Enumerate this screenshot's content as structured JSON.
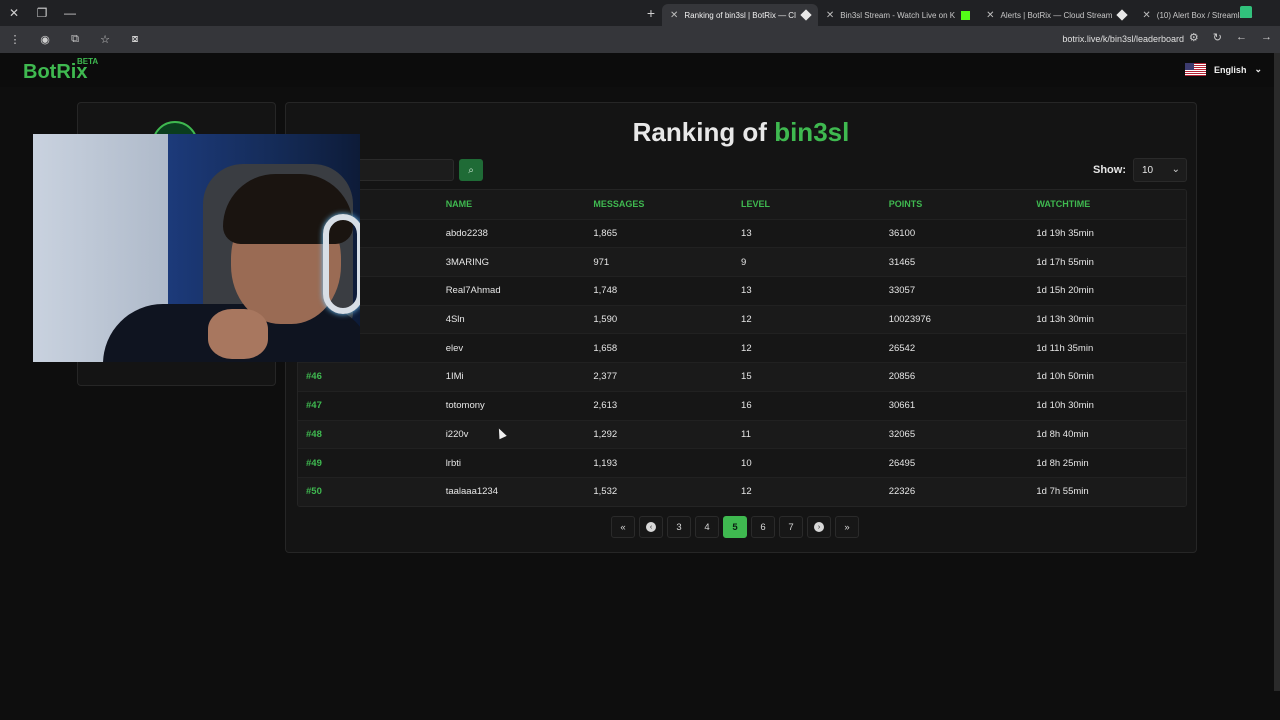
{
  "browser": {
    "tabs": [
      {
        "title": "Ranking of bin3sl | BotRix — Cl",
        "active": true
      },
      {
        "title": "Bin3sl Stream - Watch Live on K",
        "active": false
      },
      {
        "title": "Alerts | BotRix — Cloud Stream",
        "active": false
      },
      {
        "title": "(10) Alert Box / Streamlabs",
        "active": false
      }
    ],
    "url": "botrix.live/k/bin3sl/leaderboard"
  },
  "site": {
    "logo": "BotRix",
    "beta": "BETA",
    "language": "English"
  },
  "page": {
    "title_prefix": "Ranking of ",
    "title_name": "bin3sl",
    "show_label": "Show:",
    "show_value": "10"
  },
  "table": {
    "headers": [
      "NAME",
      "MESSAGES",
      "LEVEL",
      "POINTS",
      "WATCHTIME"
    ],
    "rows": [
      {
        "rank": "",
        "name": "abdo2238",
        "messages": "1,865",
        "level": "13",
        "points": "36100",
        "watchtime": "1d 19h 35min"
      },
      {
        "rank": "",
        "name": "3MARING",
        "messages": "971",
        "level": "9",
        "points": "31465",
        "watchtime": "1d 17h 55min"
      },
      {
        "rank": "",
        "name": "Real7Ahmad",
        "messages": "1,748",
        "level": "13",
        "points": "33057",
        "watchtime": "1d 15h 20min"
      },
      {
        "rank": "",
        "name": "4Sln",
        "messages": "1,590",
        "level": "12",
        "points": "10023976",
        "watchtime": "1d 13h 30min"
      },
      {
        "rank": "",
        "name": "elev",
        "messages": "1,658",
        "level": "12",
        "points": "26542",
        "watchtime": "1d 11h 35min"
      },
      {
        "rank": "#46",
        "name": "1IMi",
        "messages": "2,377",
        "level": "15",
        "points": "20856",
        "watchtime": "1d 10h 50min"
      },
      {
        "rank": "#47",
        "name": "totomony",
        "messages": "2,613",
        "level": "16",
        "points": "30661",
        "watchtime": "1d 10h 30min"
      },
      {
        "rank": "#48",
        "name": "i220v",
        "messages": "1,292",
        "level": "11",
        "points": "32065",
        "watchtime": "1d 8h 40min"
      },
      {
        "rank": "#49",
        "name": "lrbti",
        "messages": "1,193",
        "level": "10",
        "points": "26495",
        "watchtime": "1d 8h 25min"
      },
      {
        "rank": "#50",
        "name": "taalaaa1234",
        "messages": "1,532",
        "level": "12",
        "points": "22326",
        "watchtime": "1d 7h 55min"
      }
    ]
  },
  "pagination": {
    "first": "«",
    "prev": "‹",
    "pages": [
      "3",
      "4",
      "5",
      "6",
      "7"
    ],
    "current": "5",
    "next": "›",
    "last": "»"
  },
  "colors": {
    "accent": "#3fb950",
    "background": "#0e0e0e",
    "card": "#141414"
  }
}
